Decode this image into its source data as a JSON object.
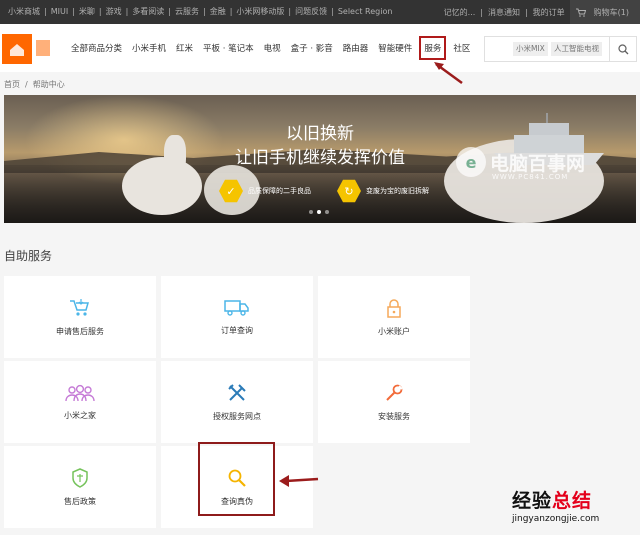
{
  "topbar": {
    "left_items": [
      "小米商城",
      "MIUI",
      "米聊",
      "游戏",
      "多看阅读",
      "云服务",
      "金融",
      "小米网移动版",
      "问题反馈",
      "Select Region"
    ],
    "right_items": [
      "记忆的...",
      "消息通知",
      "我的订单"
    ],
    "cart_label": "购物车(1)"
  },
  "header": {
    "nav_items": [
      "全部商品分类",
      "小米手机",
      "红米",
      "平板 · 笔记本",
      "电视",
      "盒子 · 影音",
      "路由器",
      "智能硬件",
      "服务",
      "社区"
    ],
    "highlighted_nav": "服务",
    "search_tags": [
      "小米MIX",
      "人工智能电视"
    ]
  },
  "breadcrumb": {
    "home": "首页",
    "separator": "/",
    "current": "帮助中心"
  },
  "banner": {
    "title_line1": "以旧换新",
    "title_line2": "让旧手机继续发挥价值",
    "badge1": "品质保障的二手良品",
    "badge2": "变废为宝的废旧拆解",
    "watermark_text": "电脑百事网",
    "watermark_url": "WWW.PC841.COM"
  },
  "self_service": {
    "title": "自助服务",
    "items": [
      {
        "label": "申请售后服务",
        "icon": "cart-icon",
        "color": "#4cb6e8"
      },
      {
        "label": "订单查询",
        "icon": "truck-icon",
        "color": "#4cb6e8"
      },
      {
        "label": "小米账户",
        "icon": "lock-icon",
        "color": "#f5a95a"
      },
      {
        "label": "小米之家",
        "icon": "people-icon",
        "color": "#c57ad6"
      },
      {
        "label": "授权服务网点",
        "icon": "tools-icon",
        "color": "#4cb6e8"
      },
      {
        "label": "安装服务",
        "icon": "wrench-icon",
        "color": "#f26b3a"
      },
      {
        "label": "售后政策",
        "icon": "policy-icon",
        "color": "#76c35c"
      },
      {
        "label": "查询真伪",
        "icon": "search-icon",
        "color": "#f5b400"
      }
    ]
  },
  "footer_brand": {
    "title_black": "经验",
    "title_red": "总结",
    "url": "jingyanzongjie.com"
  }
}
